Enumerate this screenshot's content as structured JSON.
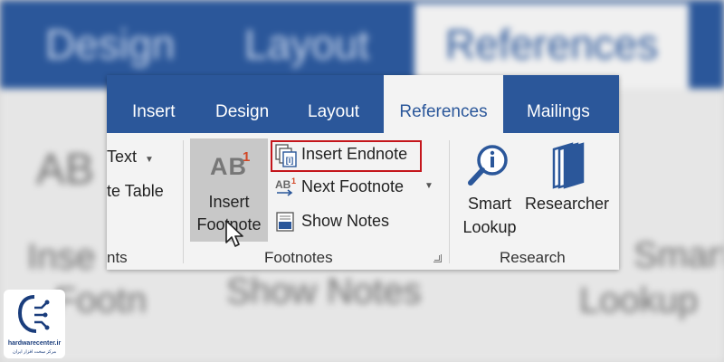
{
  "background": {
    "tabs": [
      "Design",
      "Layout",
      "References"
    ],
    "fragments": [
      "AB",
      "Inse",
      "Footn",
      "Show Notes",
      "Smart",
      "Lookup"
    ]
  },
  "ribbon": {
    "tabs": [
      {
        "label": "Insert",
        "active": false
      },
      {
        "label": "Design",
        "active": false
      },
      {
        "label": "Layout",
        "active": false
      },
      {
        "label": "References",
        "active": true
      },
      {
        "label": "Mailings",
        "active": false
      }
    ],
    "citations": {
      "text_label": "Text",
      "table_label": "te Table",
      "group_label": "nts"
    },
    "footnotes": {
      "insert_footnote_line1": "Insert",
      "insert_footnote_line2": "Footnote",
      "insert_footnote_icon_text": "AB",
      "insert_footnote_icon_sup": "1",
      "insert_endnote": "Insert Endnote",
      "next_footnote": "Next Footnote",
      "show_notes": "Show Notes",
      "group_label": "Footnotes"
    },
    "research": {
      "smart_lookup_line1": "Smart",
      "smart_lookup_line2": "Lookup",
      "researcher": "Researcher",
      "group_label": "Research"
    }
  },
  "watermark": {
    "text": "hardwarecenter.ir",
    "subtext": "مرکز سخت افزار ایران"
  },
  "colors": {
    "tab_blue": "#2b579a",
    "highlight_red": "#c4161c",
    "accent_orange": "#d24726"
  }
}
